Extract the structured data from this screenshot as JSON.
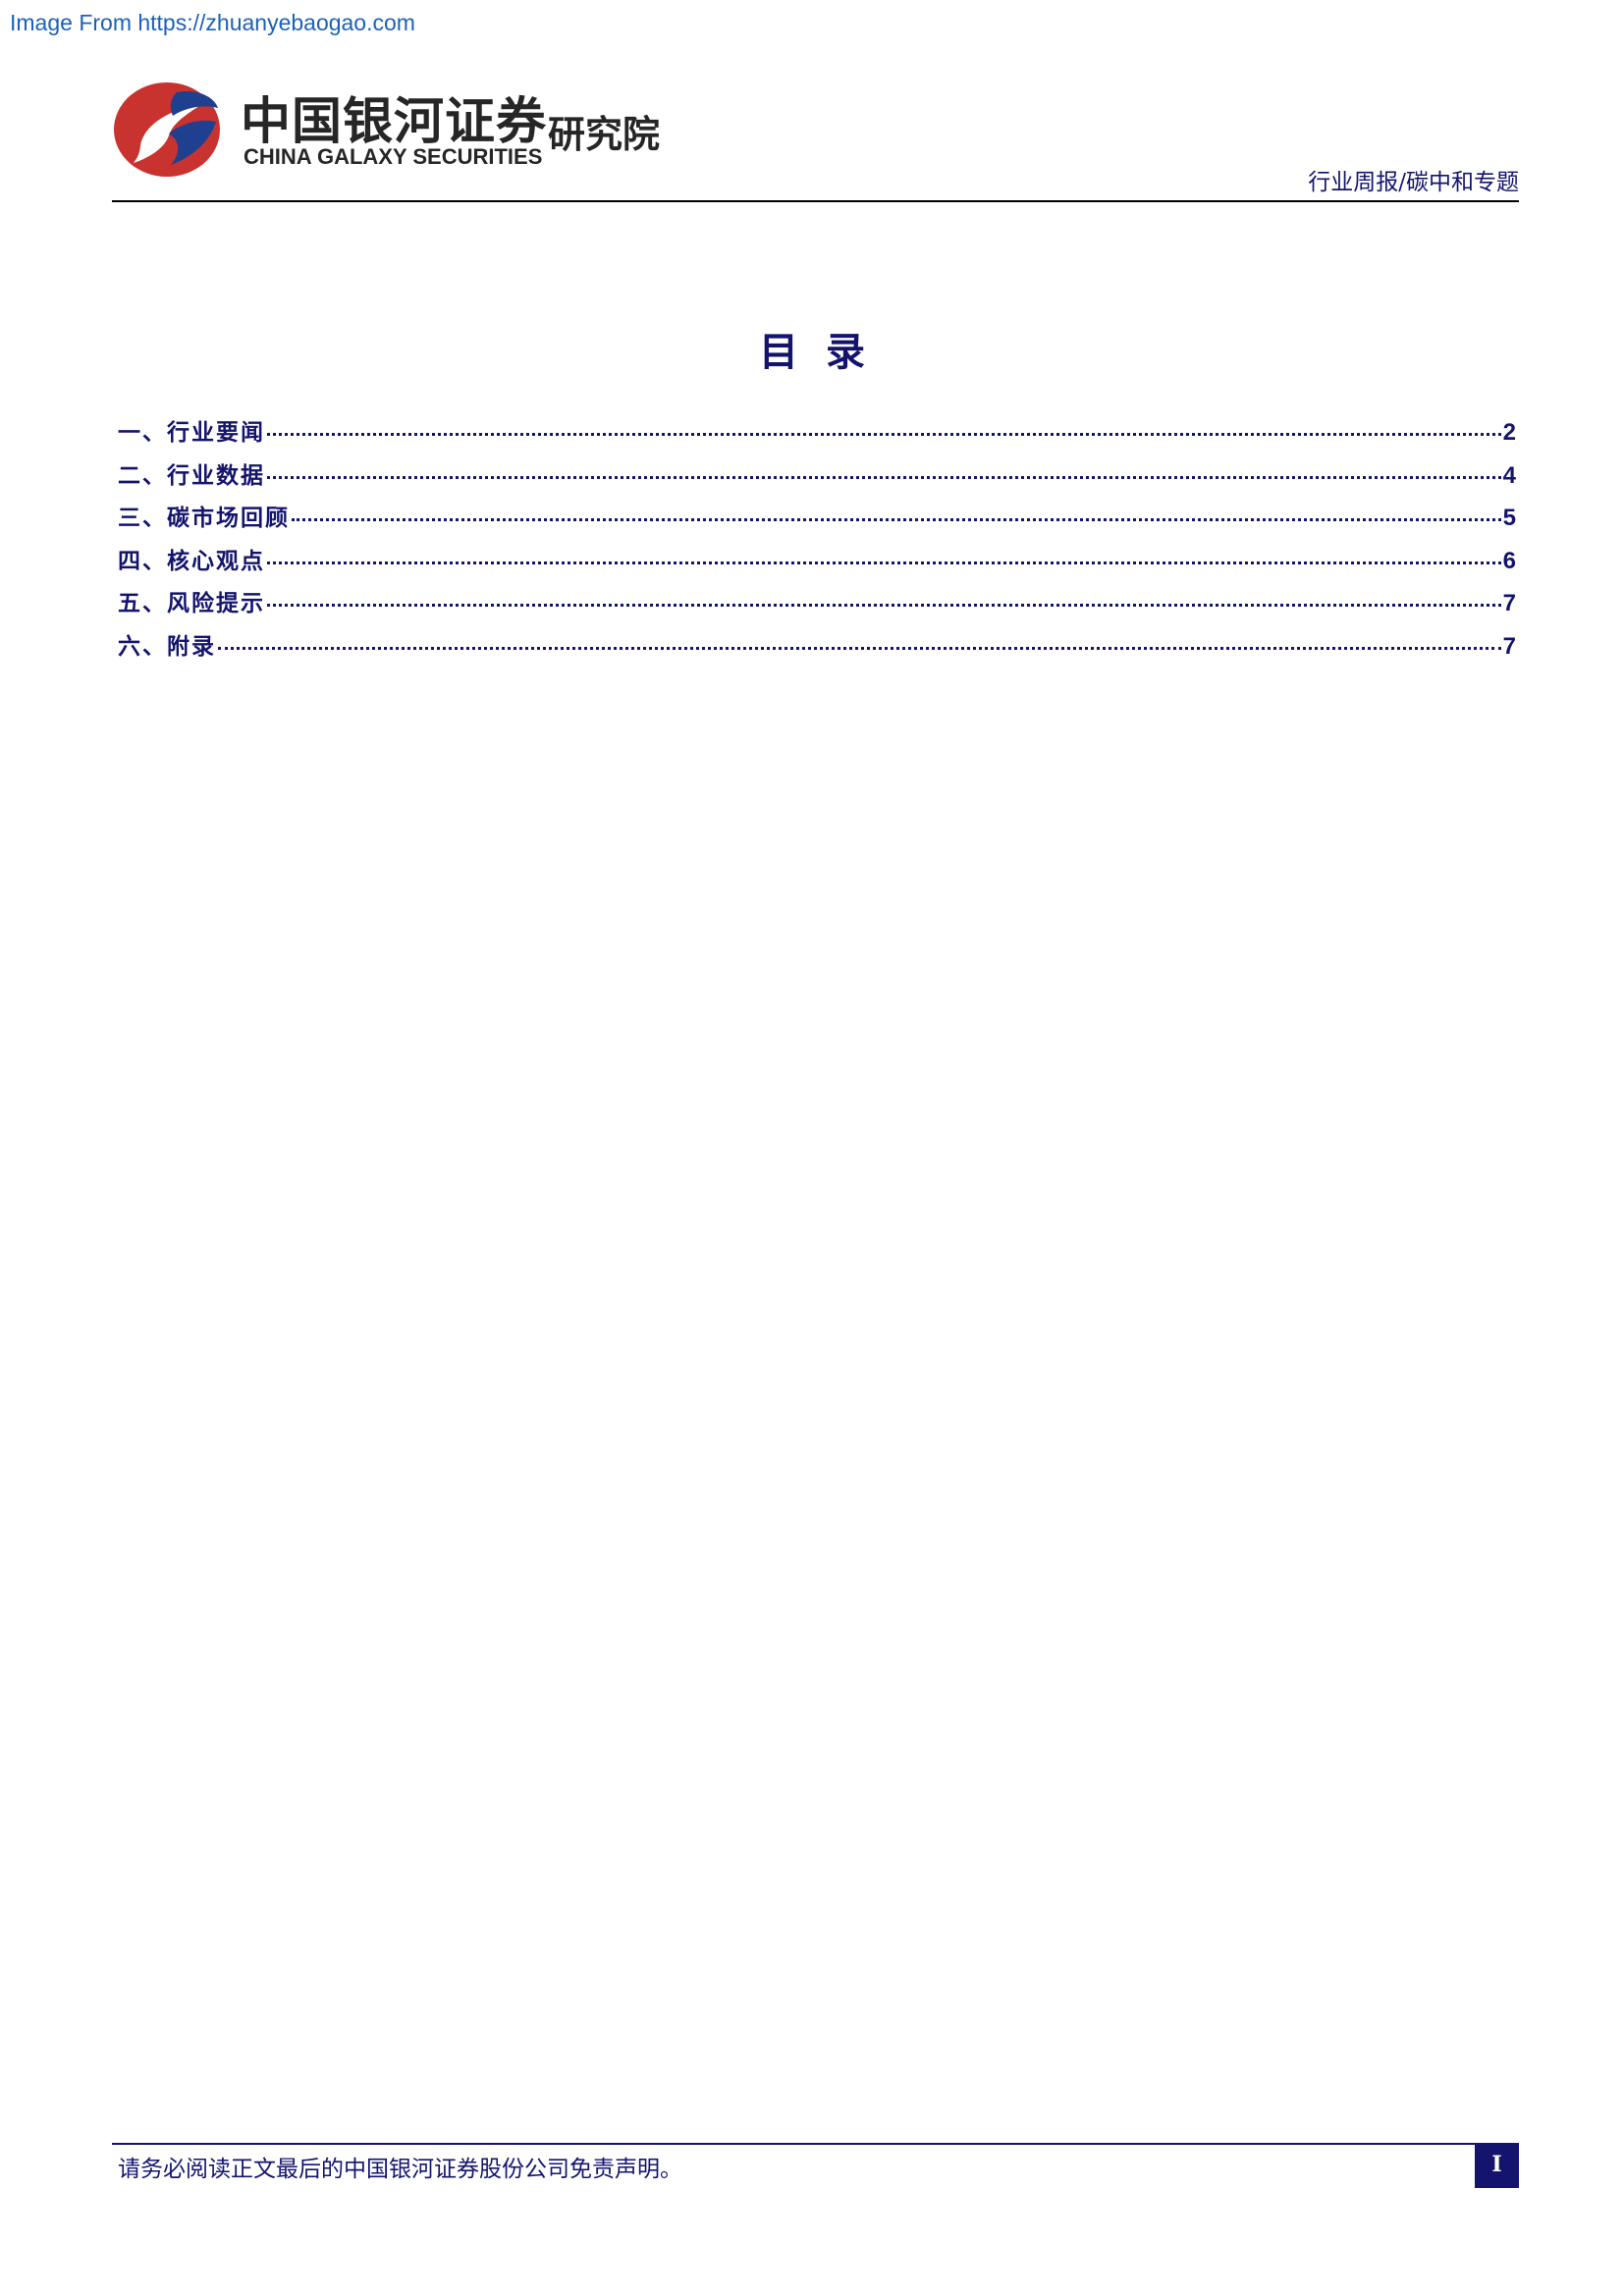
{
  "source_link": "Image From https://zhuanyebaogao.com",
  "header": {
    "brand_cn": "中国银河证券",
    "brand_en": "CHINA GALAXY SECURITIES",
    "institute": "研究院",
    "report_type": "行业周报/碳中和专题",
    "logo_colors": {
      "red": "#c8332f",
      "blue": "#1f3f8f"
    }
  },
  "toc": {
    "title": "目录",
    "items": [
      {
        "label": "一、行业要闻",
        "page": "2"
      },
      {
        "label": "二、行业数据",
        "page": "4"
      },
      {
        "label": "三、碳市场回顾",
        "page": "5"
      },
      {
        "label": "四、核心观点",
        "page": "6"
      },
      {
        "label": "五、风险提示",
        "page": "7"
      },
      {
        "label": "六、附录",
        "page": "7"
      }
    ]
  },
  "footer": {
    "disclaimer": "请务必阅读正文最后的中国银河证券股份公司免责声明。",
    "page_number": "I"
  },
  "colors": {
    "text_navy": "#14146e",
    "link_blue": "#1a62b8"
  }
}
